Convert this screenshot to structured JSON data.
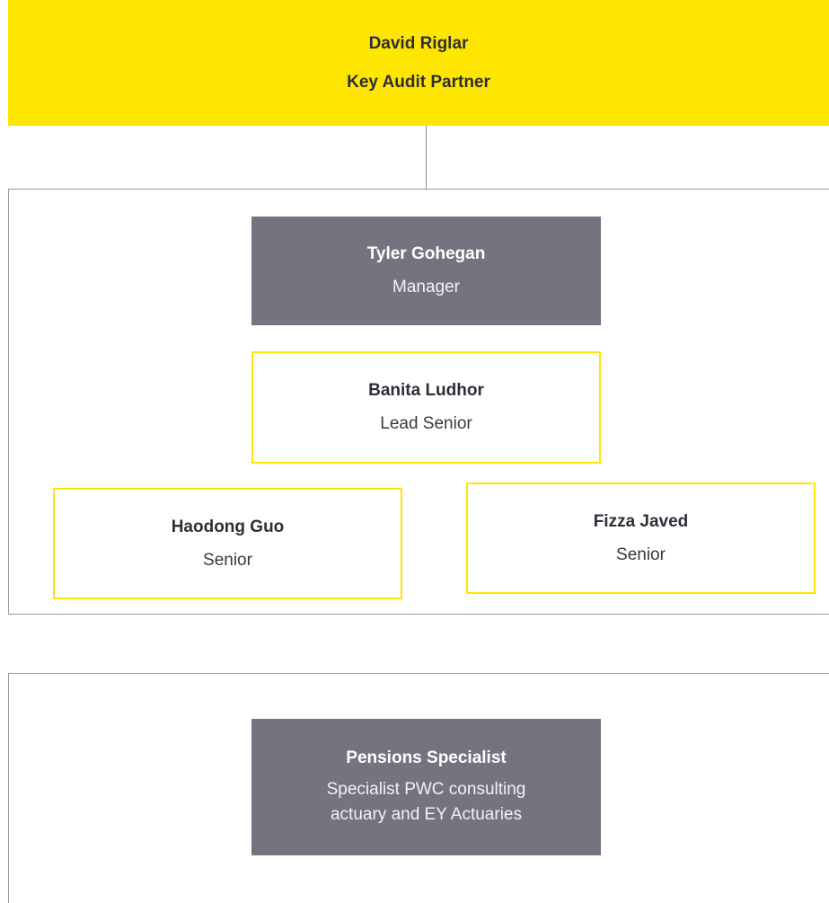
{
  "partner": {
    "name": "David Riglar",
    "role": "Key Audit Partner"
  },
  "team": {
    "manager": {
      "name": "Tyler Gohegan",
      "role": "Manager"
    },
    "lead_senior": {
      "name": "Banita Ludhor",
      "role": "Lead Senior"
    },
    "seniors": [
      {
        "name": "Haodong Guo",
        "role": "Senior"
      },
      {
        "name": "Fizza Javed",
        "role": "Senior"
      }
    ]
  },
  "specialist": {
    "name": "Pensions Specialist",
    "role": "Specialist PWC consulting\nactuary and EY Actuaries"
  },
  "colors": {
    "partner_fill": "#ffe600",
    "manager_fill": "#747480",
    "outline_border": "#ffe600",
    "panel_border": "#9a9a9a"
  }
}
